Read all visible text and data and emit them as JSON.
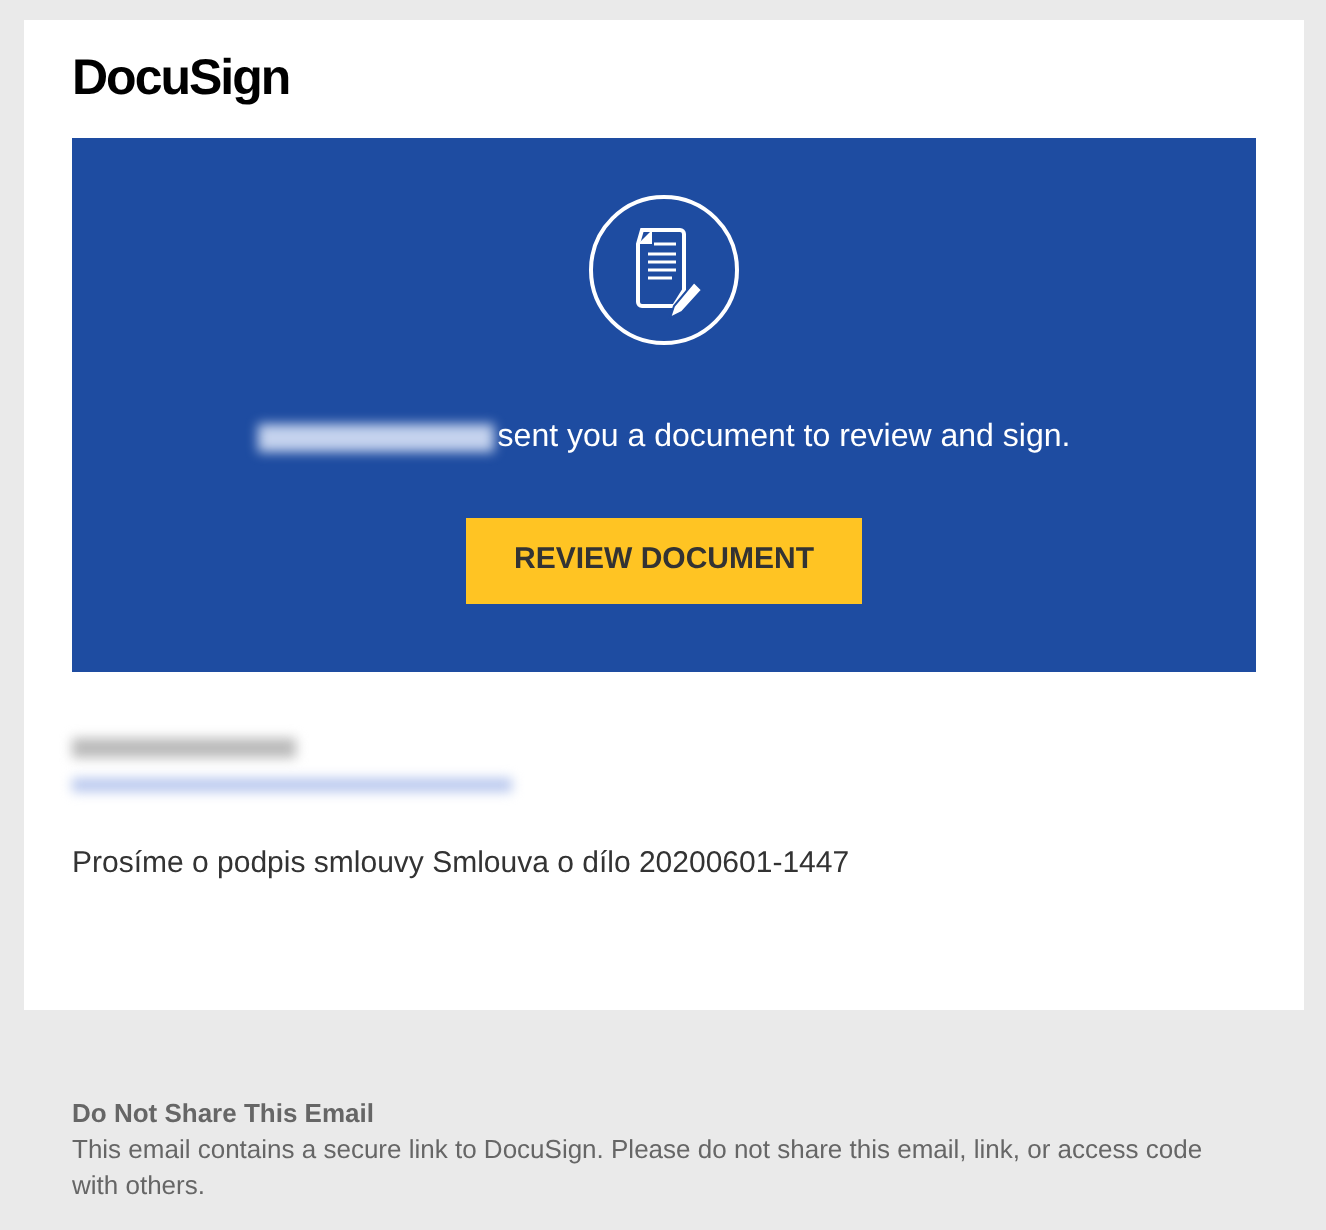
{
  "logo": "DocuSign",
  "banner": {
    "message": "sent you a document to review and sign.",
    "button": "REVIEW DOCUMENT"
  },
  "body": {
    "message": "Prosíme o podpis smlouvy Smlouva o dílo 20200601-1447"
  },
  "footer": {
    "heading": "Do Not Share This Email",
    "text": "This email contains a secure link to DocuSign. Please do not share this email, link, or access code with others."
  }
}
